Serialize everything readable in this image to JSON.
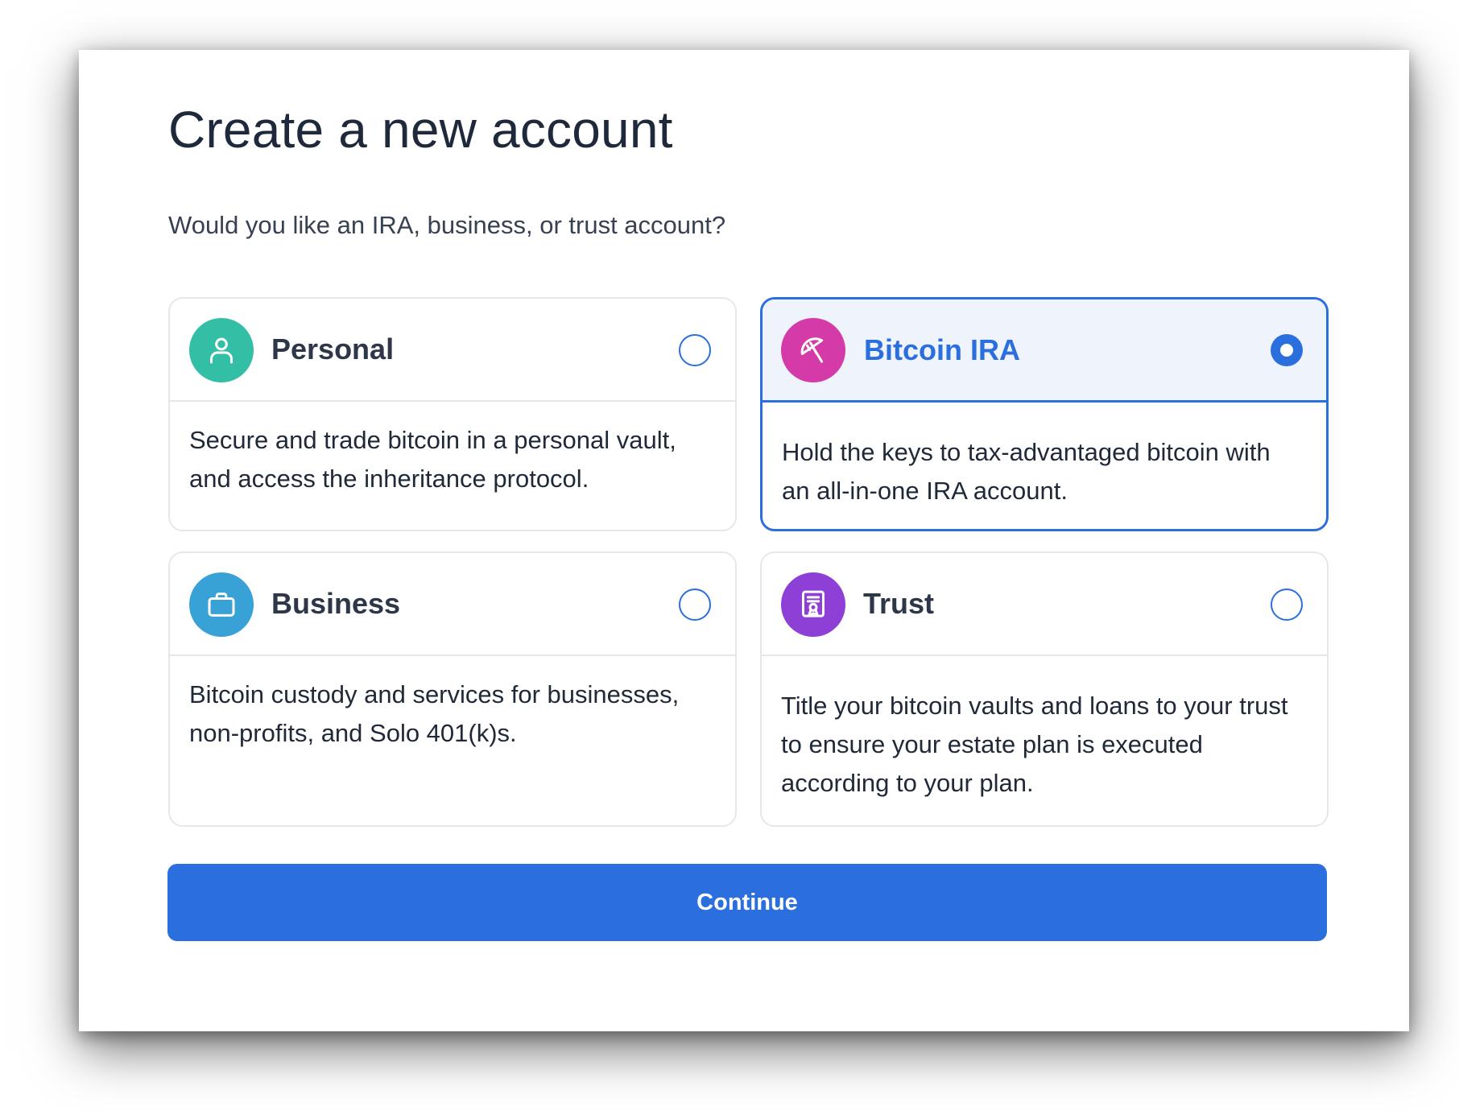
{
  "dialog": {
    "title": "Create a new account",
    "subtitle": "Would you like an IRA, business, or trust account?"
  },
  "options": [
    {
      "title": "Personal",
      "description": "Secure and trade bitcoin in a personal vault, and access the inheritance protocol.",
      "icon": "person-icon",
      "icon_color": "#33bfa5",
      "selected": false
    },
    {
      "title": "Bitcoin IRA",
      "description": "Hold the keys to tax-advantaged bitcoin with an all-in-one IRA account.",
      "icon": "umbrella-icon",
      "icon_color": "#d43aa8",
      "selected": true
    },
    {
      "title": "Business",
      "description": "Bitcoin custody and services for businesses, non-profits, and Solo 401(k)s.",
      "icon": "briefcase-icon",
      "icon_color": "#38a2d6",
      "selected": false
    },
    {
      "title": "Trust",
      "description": "Title your bitcoin vaults and loans to your trust to ensure your estate plan is executed according to your plan.",
      "icon": "certificate-icon",
      "icon_color": "#8e3fd6",
      "selected": false
    }
  ],
  "actions": {
    "continue_label": "Continue"
  },
  "colors": {
    "accent": "#2b6fde",
    "selected_header_bg": "#eef3fc",
    "card_border": "#e5e7eb"
  }
}
